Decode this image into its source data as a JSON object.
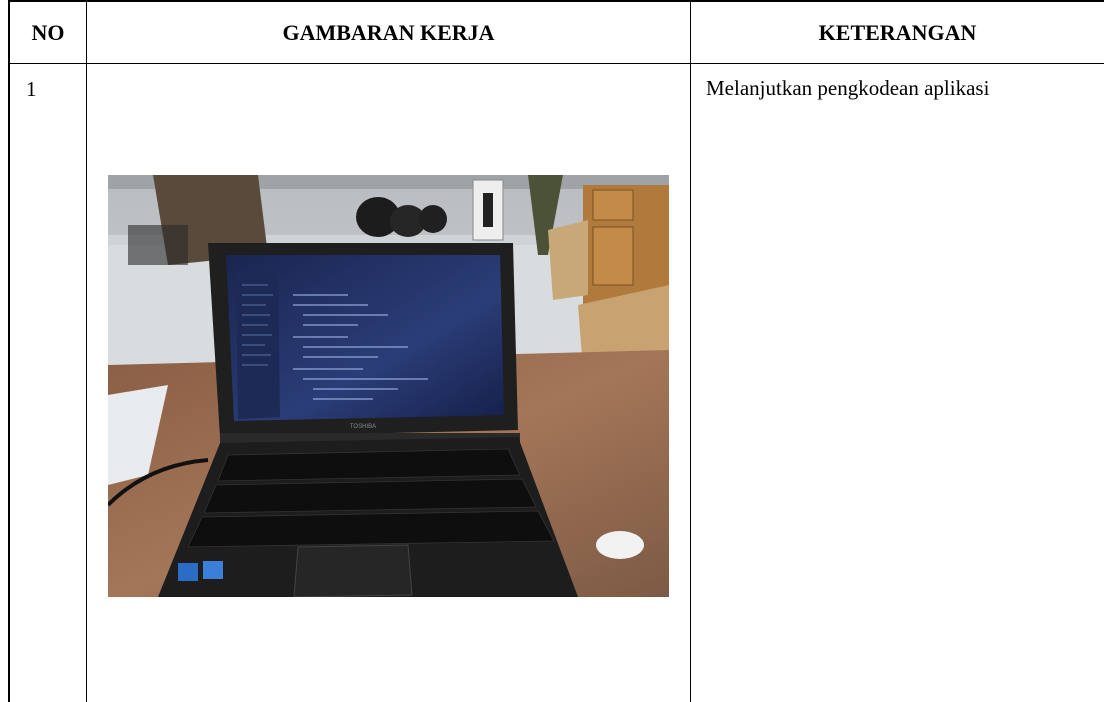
{
  "table": {
    "headers": {
      "no": "NO",
      "gambaran_kerja": "GAMBARAN KERJA",
      "keterangan": "KETERANGAN"
    },
    "rows": [
      {
        "no": "1",
        "keterangan": "Melanjutkan pengkodean aplikasi",
        "photo_text": {
          "laptop_brand": "TOSHIBA"
        }
      }
    ]
  }
}
